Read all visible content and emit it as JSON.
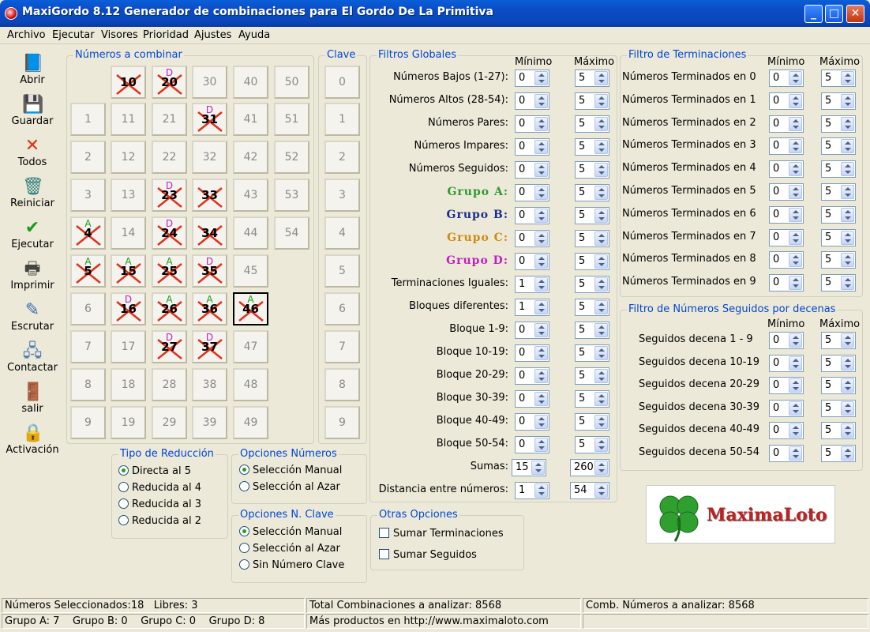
{
  "window": {
    "title": "MaxiGordo 8.12 Generador de combinaciones para El Gordo De La Primitiva",
    "minimize": "_",
    "maximize": "□",
    "close": "✕"
  },
  "menu": [
    "Archivo",
    "Ejecutar",
    "Visores",
    "Prioridad",
    "Ajustes",
    "Ayuda"
  ],
  "toolbar": [
    {
      "label": "Abrir",
      "icon": "open-book-icon"
    },
    {
      "label": "Guardar",
      "icon": "save-disk-icon"
    },
    {
      "label": "Todos",
      "icon": "red-x-icon"
    },
    {
      "label": "Reiniciar",
      "icon": "trash-icon"
    },
    {
      "label": "Ejecutar",
      "icon": "checkmark-icon"
    },
    {
      "label": "Imprimir",
      "icon": "printer-icon"
    },
    {
      "label": "Escrutar",
      "icon": "notepad-pencil-icon"
    },
    {
      "label": "Contactar",
      "icon": "network-computer-icon"
    },
    {
      "label": "salir",
      "icon": "exit-door-icon"
    },
    {
      "label": "Activación",
      "icon": "padlock-icon"
    }
  ],
  "numbers_panel": {
    "title": "Números a combinar",
    "columns": [
      [
        {
          "n": "1"
        },
        {
          "n": "2"
        },
        {
          "n": "3"
        },
        {
          "n": "4",
          "sel": true,
          "group": "A"
        },
        {
          "n": "5",
          "sel": true,
          "group": "A"
        },
        {
          "n": "6"
        },
        {
          "n": "7"
        },
        {
          "n": "8"
        },
        {
          "n": "9"
        }
      ],
      [
        {
          "n": "10",
          "sel": true
        },
        {
          "n": "11"
        },
        {
          "n": "12"
        },
        {
          "n": "13"
        },
        {
          "n": "14"
        },
        {
          "n": "15",
          "sel": true,
          "group": "A"
        },
        {
          "n": "16",
          "sel": true,
          "group": "D"
        },
        {
          "n": "17"
        },
        {
          "n": "18"
        },
        {
          "n": "19"
        }
      ],
      [
        {
          "n": "20",
          "sel": true,
          "group": "D"
        },
        {
          "n": "21"
        },
        {
          "n": "22"
        },
        {
          "n": "23",
          "sel": true,
          "group": "D"
        },
        {
          "n": "24",
          "sel": true,
          "group": "D"
        },
        {
          "n": "25",
          "sel": true,
          "group": "A"
        },
        {
          "n": "26",
          "sel": true,
          "group": "A"
        },
        {
          "n": "27",
          "sel": true,
          "group": "D"
        },
        {
          "n": "28"
        },
        {
          "n": "29"
        }
      ],
      [
        {
          "n": "30"
        },
        {
          "n": "31",
          "sel": true,
          "group": "D"
        },
        {
          "n": "32"
        },
        {
          "n": "33",
          "sel": true
        },
        {
          "n": "34",
          "sel": true
        },
        {
          "n": "35",
          "sel": true,
          "group": "D"
        },
        {
          "n": "36",
          "sel": true,
          "group": "A"
        },
        {
          "n": "37",
          "sel": true,
          "group": "D"
        },
        {
          "n": "38"
        },
        {
          "n": "39"
        }
      ],
      [
        {
          "n": "40"
        },
        {
          "n": "41"
        },
        {
          "n": "42"
        },
        {
          "n": "43"
        },
        {
          "n": "44"
        },
        {
          "n": "45"
        },
        {
          "n": "46",
          "sel": true,
          "group": "A",
          "focus": true
        },
        {
          "n": "47"
        },
        {
          "n": "48"
        },
        {
          "n": "49"
        }
      ],
      [
        {
          "n": "50"
        },
        {
          "n": "51"
        },
        {
          "n": "52"
        },
        {
          "n": "53"
        },
        {
          "n": "54"
        }
      ]
    ]
  },
  "clave_panel": {
    "title": "Clave",
    "values": [
      "0",
      "1",
      "2",
      "3",
      "4",
      "5",
      "6",
      "7",
      "8",
      "9"
    ]
  },
  "filtros_globales": {
    "title": "Filtros Globales",
    "min_header": "Mínimo",
    "max_header": "Máximo",
    "rows": [
      {
        "label": "Números Bajos (1-27):",
        "min": "0",
        "max": "5"
      },
      {
        "label": "Números Altos (28-54):",
        "min": "0",
        "max": "5"
      },
      {
        "label": "Números Pares:",
        "min": "0",
        "max": "5"
      },
      {
        "label": "Números Impares:",
        "min": "0",
        "max": "5"
      },
      {
        "label": "Números Seguidos:",
        "min": "0",
        "max": "5"
      },
      {
        "label": "Grupo  A:",
        "min": "0",
        "max": "5",
        "color": "#2f9a2f"
      },
      {
        "label": "Grupo  B:",
        "min": "0",
        "max": "5",
        "color": "#1c2e8c"
      },
      {
        "label": "Grupo  C:",
        "min": "0",
        "max": "5",
        "color": "#d08a10"
      },
      {
        "label": "Grupo  D:",
        "min": "0",
        "max": "5",
        "color": "#c020c0"
      },
      {
        "label": "Terminaciones Iguales:",
        "min": "1",
        "max": "5"
      },
      {
        "label": "Bloques diferentes:",
        "min": "1",
        "max": "5"
      },
      {
        "label": "Bloque 1-9:",
        "min": "0",
        "max": "5"
      },
      {
        "label": "Bloque 10-19:",
        "min": "0",
        "max": "5"
      },
      {
        "label": "Bloque 20-29:",
        "min": "0",
        "max": "5"
      },
      {
        "label": "Bloque 30-39:",
        "min": "0",
        "max": "5"
      },
      {
        "label": "Bloque 40-49:",
        "min": "0",
        "max": "5"
      },
      {
        "label": "Bloque 50-54:",
        "min": "0",
        "max": "5"
      },
      {
        "label": "Sumas:",
        "min": "15",
        "max": "260"
      },
      {
        "label": "Distancia entre números:",
        "min": "1",
        "max": "54"
      }
    ]
  },
  "filtro_terminaciones": {
    "title": "Filtro de Terminaciones",
    "min_header": "Mínimo",
    "max_header": "Máximo",
    "rows": [
      {
        "label": "Números Terminados en 0",
        "min": "0",
        "max": "5"
      },
      {
        "label": "Números Terminados en 1",
        "min": "0",
        "max": "5"
      },
      {
        "label": "Números Terminados en 2",
        "min": "0",
        "max": "5"
      },
      {
        "label": "Números Terminados en 3",
        "min": "0",
        "max": "5"
      },
      {
        "label": "Números Terminados en 4",
        "min": "0",
        "max": "5"
      },
      {
        "label": "Números Terminados en 5",
        "min": "0",
        "max": "5"
      },
      {
        "label": "Números Terminados en 6",
        "min": "0",
        "max": "5"
      },
      {
        "label": "Números Terminados en 7",
        "min": "0",
        "max": "5"
      },
      {
        "label": "Números Terminados en 8",
        "min": "0",
        "max": "5"
      },
      {
        "label": "Números Terminados en 9",
        "min": "0",
        "max": "5"
      }
    ]
  },
  "filtro_seguidos": {
    "title": "Filtro de Números Seguidos por decenas",
    "min_header": "Mínimo",
    "max_header": "Máximo",
    "rows": [
      {
        "label": "Seguidos decena  1 - 9",
        "min": "0",
        "max": "5"
      },
      {
        "label": "Seguidos decena 10-19",
        "min": "0",
        "max": "5"
      },
      {
        "label": "Seguidos decena 20-29",
        "min": "0",
        "max": "5"
      },
      {
        "label": "Seguidos decena 30-39",
        "min": "0",
        "max": "5"
      },
      {
        "label": "Seguidos decena 40-49",
        "min": "0",
        "max": "5"
      },
      {
        "label": "Seguidos decena 50-54",
        "min": "0",
        "max": "5"
      }
    ]
  },
  "tipo_reduccion": {
    "title": "Tipo de Reducción",
    "options": [
      {
        "label": "Directa al 5",
        "checked": true
      },
      {
        "label": "Reducida al 4",
        "checked": false
      },
      {
        "label": "Reducida al 3",
        "checked": false
      },
      {
        "label": "Reducida al 2",
        "checked": false
      }
    ]
  },
  "opciones_numeros": {
    "title": "Opciones Números",
    "options": [
      {
        "label": "Selección Manual",
        "checked": true
      },
      {
        "label": "Selección al Azar",
        "checked": false
      }
    ]
  },
  "opciones_clave": {
    "title": "Opciones N. Clave",
    "options": [
      {
        "label": "Selección Manual",
        "checked": true
      },
      {
        "label": "Selección al Azar",
        "checked": false
      },
      {
        "label": "Sin Número Clave",
        "checked": false
      }
    ]
  },
  "otras_opciones": {
    "title": "Otras Opciones",
    "options": [
      {
        "label": "Sumar Terminaciones",
        "checked": false
      },
      {
        "label": "Sumar Seguidos",
        "checked": false
      }
    ]
  },
  "logo": {
    "text": "MaximaLoto"
  },
  "status": {
    "seleccionados": "Números Seleccionados:18",
    "libres": "Libres: 3",
    "total": "Total Combinaciones a analizar: 8568",
    "comb": "Comb. Números a analizar: 8568",
    "grupo_a": "Grupo A: 7",
    "grupo_b": "Grupo B: 0",
    "grupo_c": "Grupo C: 0",
    "grupo_d": "Grupo D: 8",
    "productos": "Más productos en http://www.maximaloto.com"
  }
}
